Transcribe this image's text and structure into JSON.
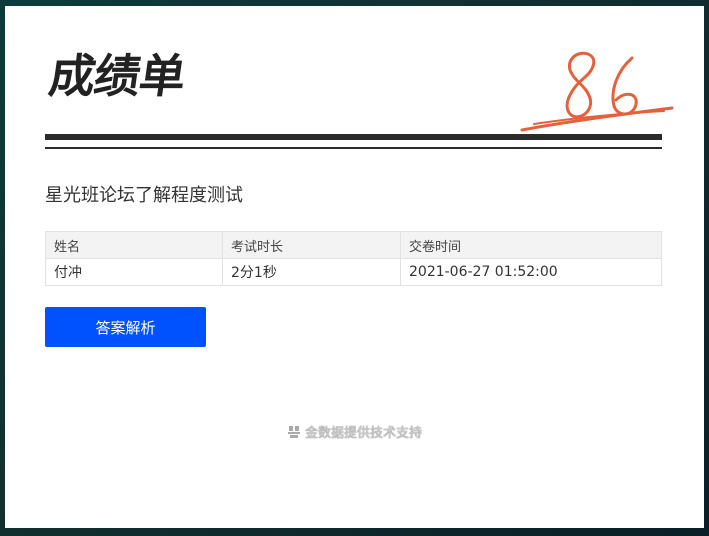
{
  "header": {
    "title": "成绩单",
    "score": "86"
  },
  "exam": {
    "title": "星光班论坛了解程度测试"
  },
  "table": {
    "headers": [
      "姓名",
      "考试时长",
      "交卷时间"
    ],
    "row": [
      "付冲",
      "2分1秒",
      "2021-06-27 01:52:00"
    ]
  },
  "actions": {
    "analysis_label": "答案解析"
  },
  "footer": {
    "text": "金数据提供技术支持"
  },
  "colors": {
    "accent": "#0052ff",
    "score": "#e5603b",
    "rule": "#2b2b2b"
  }
}
